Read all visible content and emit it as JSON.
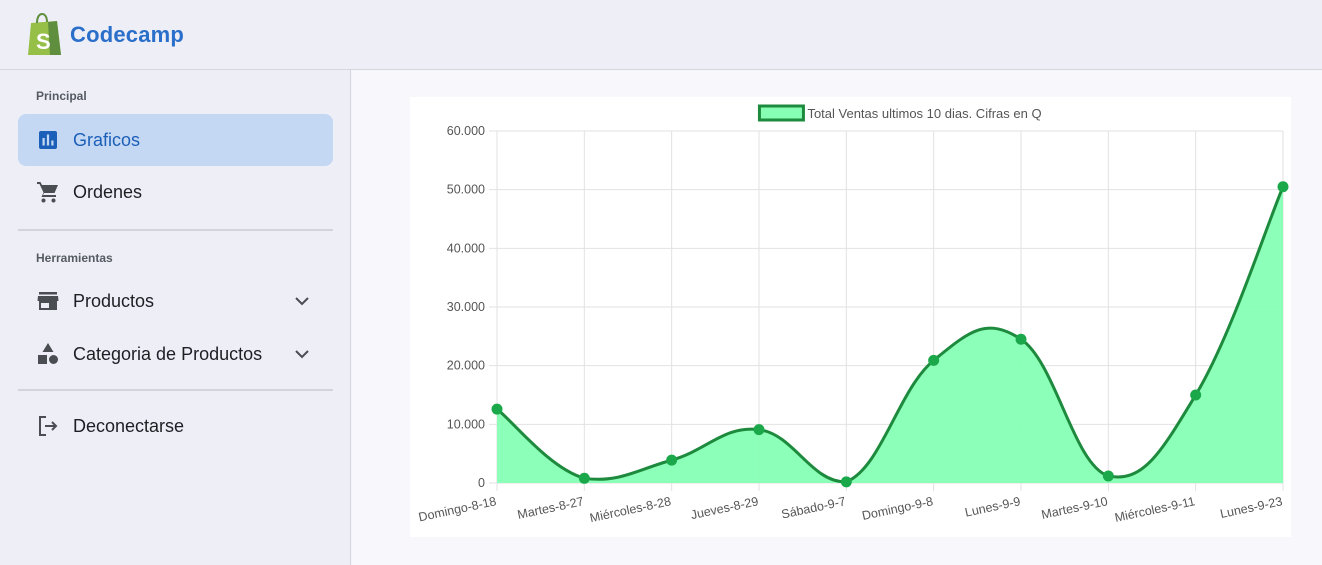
{
  "header": {
    "brand": "Codecamp",
    "logo_icon": "shopify-bag-icon"
  },
  "sidebar": {
    "section1": "Principal",
    "section2": "Herramientas",
    "items": [
      {
        "label": "Graficos",
        "icon": "bar-chart-icon",
        "active": true
      },
      {
        "label": "Ordenes",
        "icon": "cart-icon"
      },
      {
        "label": "Productos",
        "icon": "store-icon",
        "expandable": true
      },
      {
        "label": "Categoria de Productos",
        "icon": "shapes-icon",
        "expandable": true
      },
      {
        "label": "Deconectarse",
        "icon": "logout-icon"
      }
    ]
  },
  "colors": {
    "accent": "#1c5fb8",
    "line": "#1e8a3e",
    "fill": "#86ffb4",
    "point": "#1ba84a"
  },
  "chart_data": {
    "type": "line",
    "filled": true,
    "smooth": true,
    "legend": "Total Ventas ultimos 10 dias. Cifras en Q",
    "legend_position": "top",
    "grid": true,
    "categories": [
      "Domingo-8-18",
      "Martes-8-27",
      "Miércoles-8-28",
      "Jueves-8-29",
      "Sábado-9-7",
      "Domingo-9-8",
      "Lunes-9-9",
      "Martes-9-10",
      "Miércoles-9-11",
      "Lunes-9-23"
    ],
    "values": [
      12600,
      800,
      3900,
      9100,
      200,
      20900,
      24500,
      1200,
      15000,
      50500
    ],
    "ylim": [
      0,
      60000
    ],
    "yticks": [
      {
        "value": 60000,
        "label": "60.000"
      },
      {
        "value": 50000,
        "label": "50.000"
      },
      {
        "value": 40000,
        "label": "40.000"
      },
      {
        "value": 30000,
        "label": "30.000"
      },
      {
        "value": 20000,
        "label": "20.000"
      },
      {
        "value": 10000,
        "label": "10.000"
      },
      {
        "value": 0,
        "label": "0"
      }
    ]
  }
}
